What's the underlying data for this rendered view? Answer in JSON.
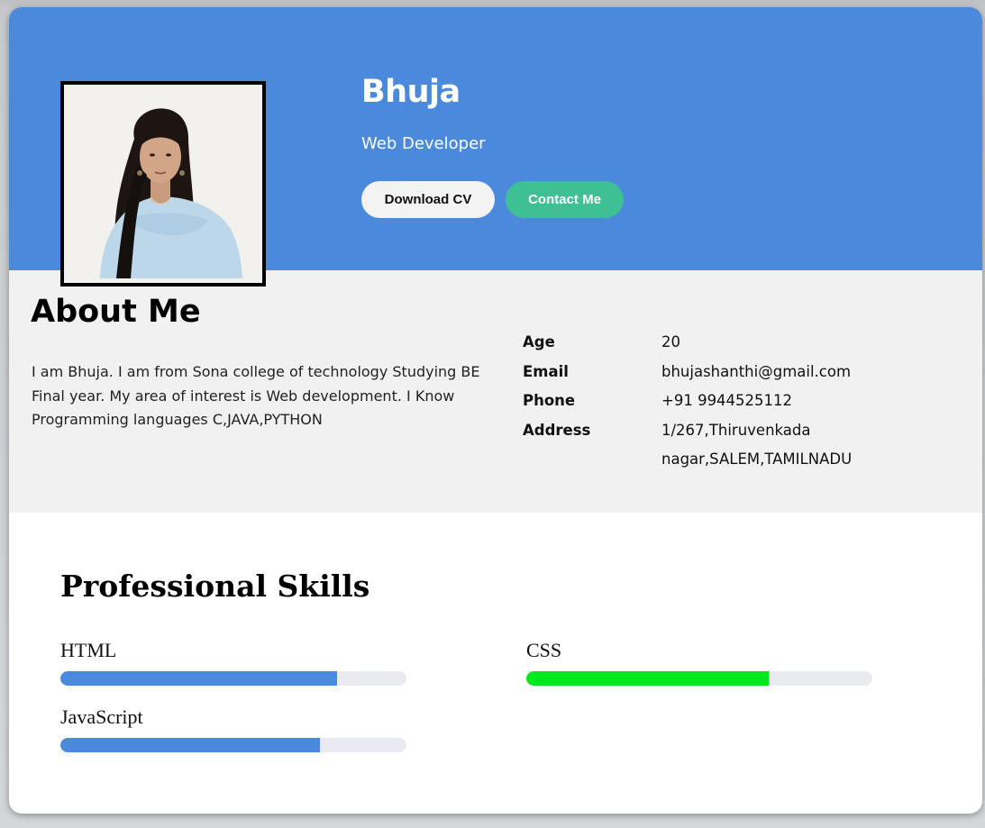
{
  "profile": {
    "name": "Bhuja",
    "role": "Web Developer",
    "photo_alt": "Profile photo",
    "buttons": {
      "download": "Download CV",
      "contact": "Contact Me"
    }
  },
  "about": {
    "title": "About Me",
    "text": "I am Bhuja. I am from Sona college of technology Studying BE Final year. My area of interest is Web development. I Know Programming languages C,JAVA,PYTHON",
    "details": [
      {
        "label": "Age",
        "value": "20"
      },
      {
        "label": "Email",
        "value": "bhujashanthi@gmail.com"
      },
      {
        "label": "Phone",
        "value": "+91 9944525112"
      },
      {
        "label": "Address",
        "value": "1/267,Thiruvenkada nagar,SALEM,TAMILNADU"
      }
    ]
  },
  "skills": {
    "title": "Professional Skills",
    "items": [
      {
        "name": "HTML",
        "level": 0.8,
        "color": "#4a89dc"
      },
      {
        "name": "CSS",
        "level": 0.7,
        "color": "#00e81e"
      },
      {
        "name": "JavaScript",
        "level": 0.75,
        "color": "#4a89dc"
      }
    ]
  },
  "colors": {
    "hero": "#4a89dc",
    "contact_button": "#3ebf94",
    "about_background": "#f1f1f1",
    "skill_track": "#e9ebf0"
  }
}
